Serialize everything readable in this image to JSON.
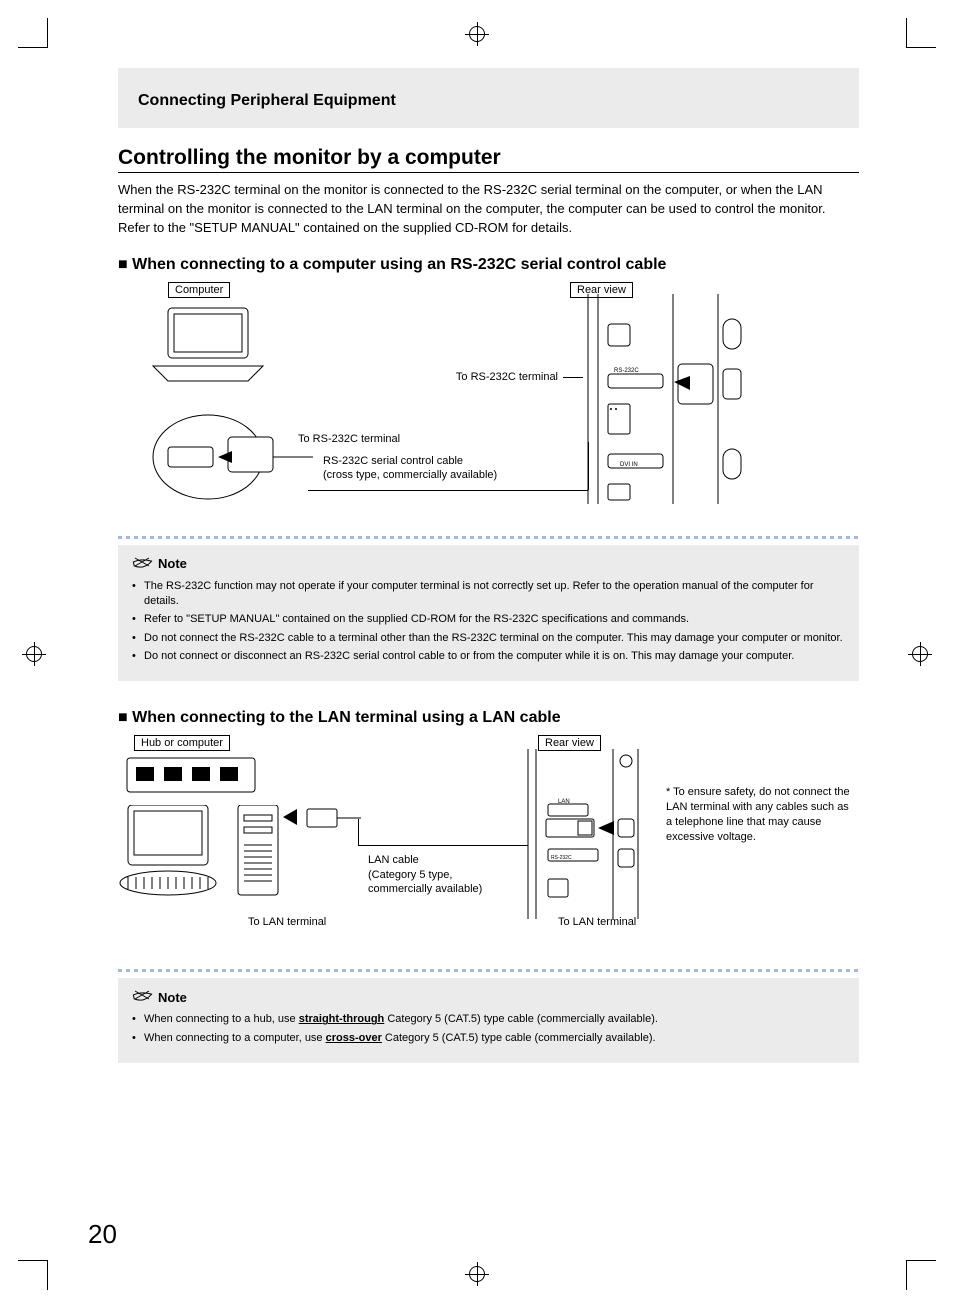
{
  "header": {
    "breadcrumb": "Connecting Peripheral Equipment"
  },
  "title": "Controlling the monitor by a computer",
  "intro": "When the RS-232C terminal on the monitor is connected to the RS-232C serial terminal on the computer, or when the LAN terminal on the monitor is connected to the LAN terminal on the computer, the computer can be used to control the monitor. Refer to the \"SETUP MANUAL\" contained on the supplied CD-ROM for details.",
  "section1": {
    "heading": "■ When connecting to a computer using an RS-232C serial control cable",
    "labels": {
      "computer": "Computer",
      "rear_view": "Rear view",
      "to_rs232c_right": "To RS-232C terminal",
      "to_rs232c_left": "To RS-232C terminal",
      "cable1": "RS-232C serial control cable",
      "cable2": "(cross type, commercially available)"
    }
  },
  "note1": {
    "label": "Note",
    "items": [
      "The RS-232C function may not operate if your computer terminal is not correctly set up. Refer to the operation manual of the computer for details.",
      "Refer to \"SETUP MANUAL\" contained on the supplied CD-ROM for the RS-232C specifications and commands.",
      "Do not connect the RS-232C cable to a terminal other than the RS-232C terminal on the computer. This may damage your computer or monitor.",
      "Do not connect or disconnect an RS-232C serial control cable to or from the computer while it is on. This may damage your computer."
    ]
  },
  "section2": {
    "heading": "■ When connecting to the LAN terminal using a LAN cable",
    "labels": {
      "hub": "Hub or computer",
      "rear_view": "Rear view",
      "lan_cable1": "LAN cable",
      "lan_cable2": "(Category 5 type,",
      "lan_cable3": "commercially available)",
      "to_lan_left": "To LAN terminal",
      "to_lan_right": "To LAN terminal"
    },
    "side_note": "* To ensure safety, do not connect the LAN terminal with any cables such as a telephone line that may cause excessive voltage."
  },
  "note2": {
    "label": "Note",
    "items_html": [
      {
        "pre": "When connecting to a hub, use ",
        "u": "straight-through",
        "post": " Category 5 (CAT.5) type cable (commercially available)."
      },
      {
        "pre": "When connecting to a computer, use ",
        "u": "cross-over",
        "post": " Category 5 (CAT.5) type cable (commercially available)."
      }
    ]
  },
  "page_number": "20"
}
